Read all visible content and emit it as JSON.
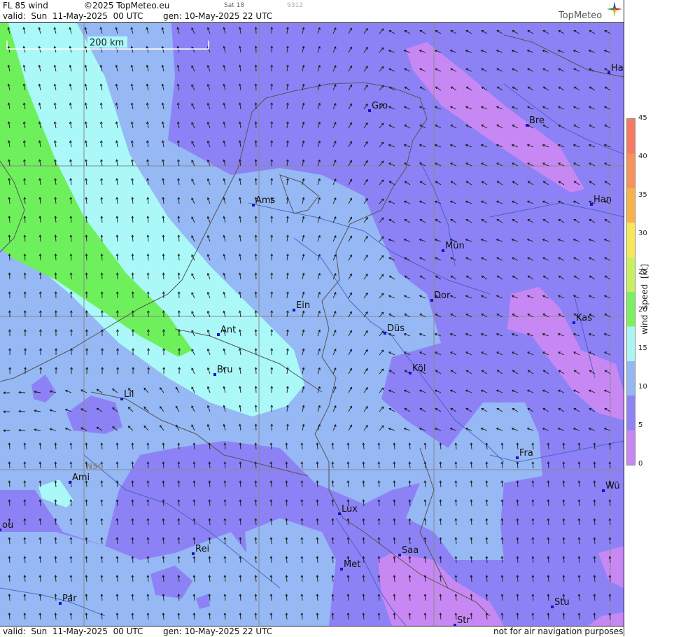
{
  "header": {
    "product": "FL 85 wind",
    "copyright": "©2025 TopMeteo.eu",
    "valid": "valid:  Sun  11-May-2025  00 UTC",
    "generated": "gen: 10-May-2025 22 UTC",
    "sat": "Sat 18",
    "code": "9312",
    "logo": "TopMeteo"
  },
  "footer": {
    "valid": "valid:  Sun  11-May-2025  00 UTC",
    "generated": "gen: 10-May-2025 22 UTC",
    "disclaimer": "not for air navigation purposes"
  },
  "map": {
    "scale_label": "200 km",
    "lat_label": "N50",
    "cities": [
      {
        "name": "Gro"
      },
      {
        "name": "Bre"
      },
      {
        "name": "Ha"
      },
      {
        "name": "Han"
      },
      {
        "name": "Ams"
      },
      {
        "name": "Mün"
      },
      {
        "name": "Dor"
      },
      {
        "name": "Ein"
      },
      {
        "name": "Kas"
      },
      {
        "name": "Ant"
      },
      {
        "name": "Düs"
      },
      {
        "name": "Bru"
      },
      {
        "name": "Köl"
      },
      {
        "name": "Lil"
      },
      {
        "name": "Fra"
      },
      {
        "name": "Ami"
      },
      {
        "name": "Wü"
      },
      {
        "name": "Lux"
      },
      {
        "name": "ou"
      },
      {
        "name": "Rei"
      },
      {
        "name": "Saa"
      },
      {
        "name": "Met"
      },
      {
        "name": "Par"
      },
      {
        "name": "Stu"
      },
      {
        "name": "Str"
      }
    ]
  },
  "colorbar": {
    "title": "wind  speed  [kt]",
    "ticks": [
      "45",
      "40",
      "35",
      "30",
      "25",
      "20",
      "15",
      "10",
      "5",
      "0"
    ],
    "colors": [
      "#f47a62",
      "#f6925a",
      "#f8b24a",
      "#f7e85a",
      "#c8f060",
      "#7cf05e",
      "#aaf6f6",
      "#94b8f2",
      "#8e82f4",
      "#c686f4"
    ]
  },
  "palette": {
    "purple_light": "#c888f4",
    "violet": "#8c82f6",
    "blue": "#96b8f4",
    "cyan": "#aaf8f8",
    "green": "#6ef05c",
    "city_marker": "#1414c8",
    "border": "#555555",
    "river": "#3a5ab8"
  }
}
